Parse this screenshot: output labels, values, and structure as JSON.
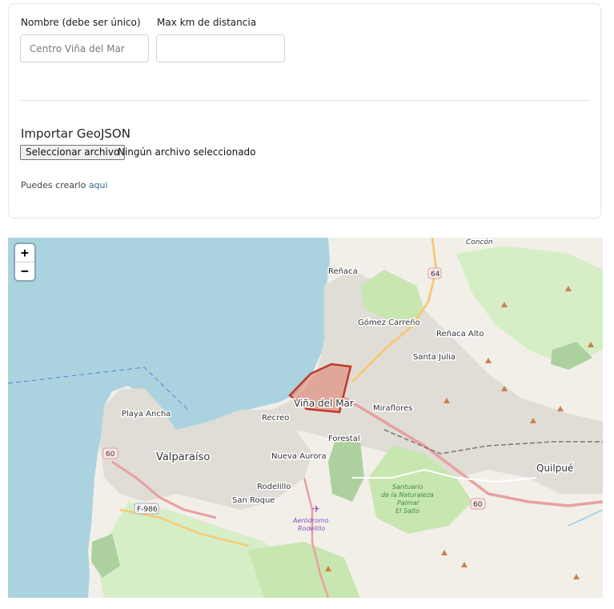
{
  "form": {
    "name_label": "Nombre (debe ser único)",
    "name_placeholder": "Centro Viña del Mar",
    "name_value": "",
    "distance_label": "Max km de distancia",
    "distance_value": "",
    "import_title": "Importar GeoJSON",
    "file_button_label": "Seleccionar archivo",
    "file_status": "Ningún archivo seleccionado",
    "hint_text": "Puedes crearlo",
    "hint_link": "aqui"
  },
  "map": {
    "zoom_in": "+",
    "zoom_out": "−",
    "labels": {
      "concon": "Concón",
      "renaca": "Reñaca",
      "route_64": "64",
      "gomez_carreno": "Gómez Carreño",
      "renaca_alto": "Reñaca Alto",
      "santa_julia": "Santa Julia",
      "vina_del_mar": "Viña del Mar",
      "miraflores": "Miraflores",
      "playa_ancha": "Playa Ancha",
      "recreo": "Recreo",
      "forestal": "Forestal",
      "route_60_west": "60",
      "valparaiso": "Valparaíso",
      "nueva_aurora": "Nueva Aurora",
      "quilpue": "Quilpué",
      "rodelillo": "Rodelillo",
      "f986": "F-986",
      "santuario_1": "Santuario",
      "santuario_2": "de la Naturaleza",
      "santuario_3": "Palmar",
      "santuario_4": "El Salto",
      "route_60_east": "60",
      "san_roque": "San Roque",
      "aerodromo_1": "Aeródromo",
      "aerodromo_2": "Rodelillo"
    },
    "colors": {
      "sea": "#aad3df",
      "land": "#f2efe9",
      "urban": "#e0dfdf",
      "park": "#c8e6b0",
      "wood": "#add19e",
      "polygon_fill": "#e07a6a",
      "polygon_stroke": "#c0392b"
    }
  }
}
